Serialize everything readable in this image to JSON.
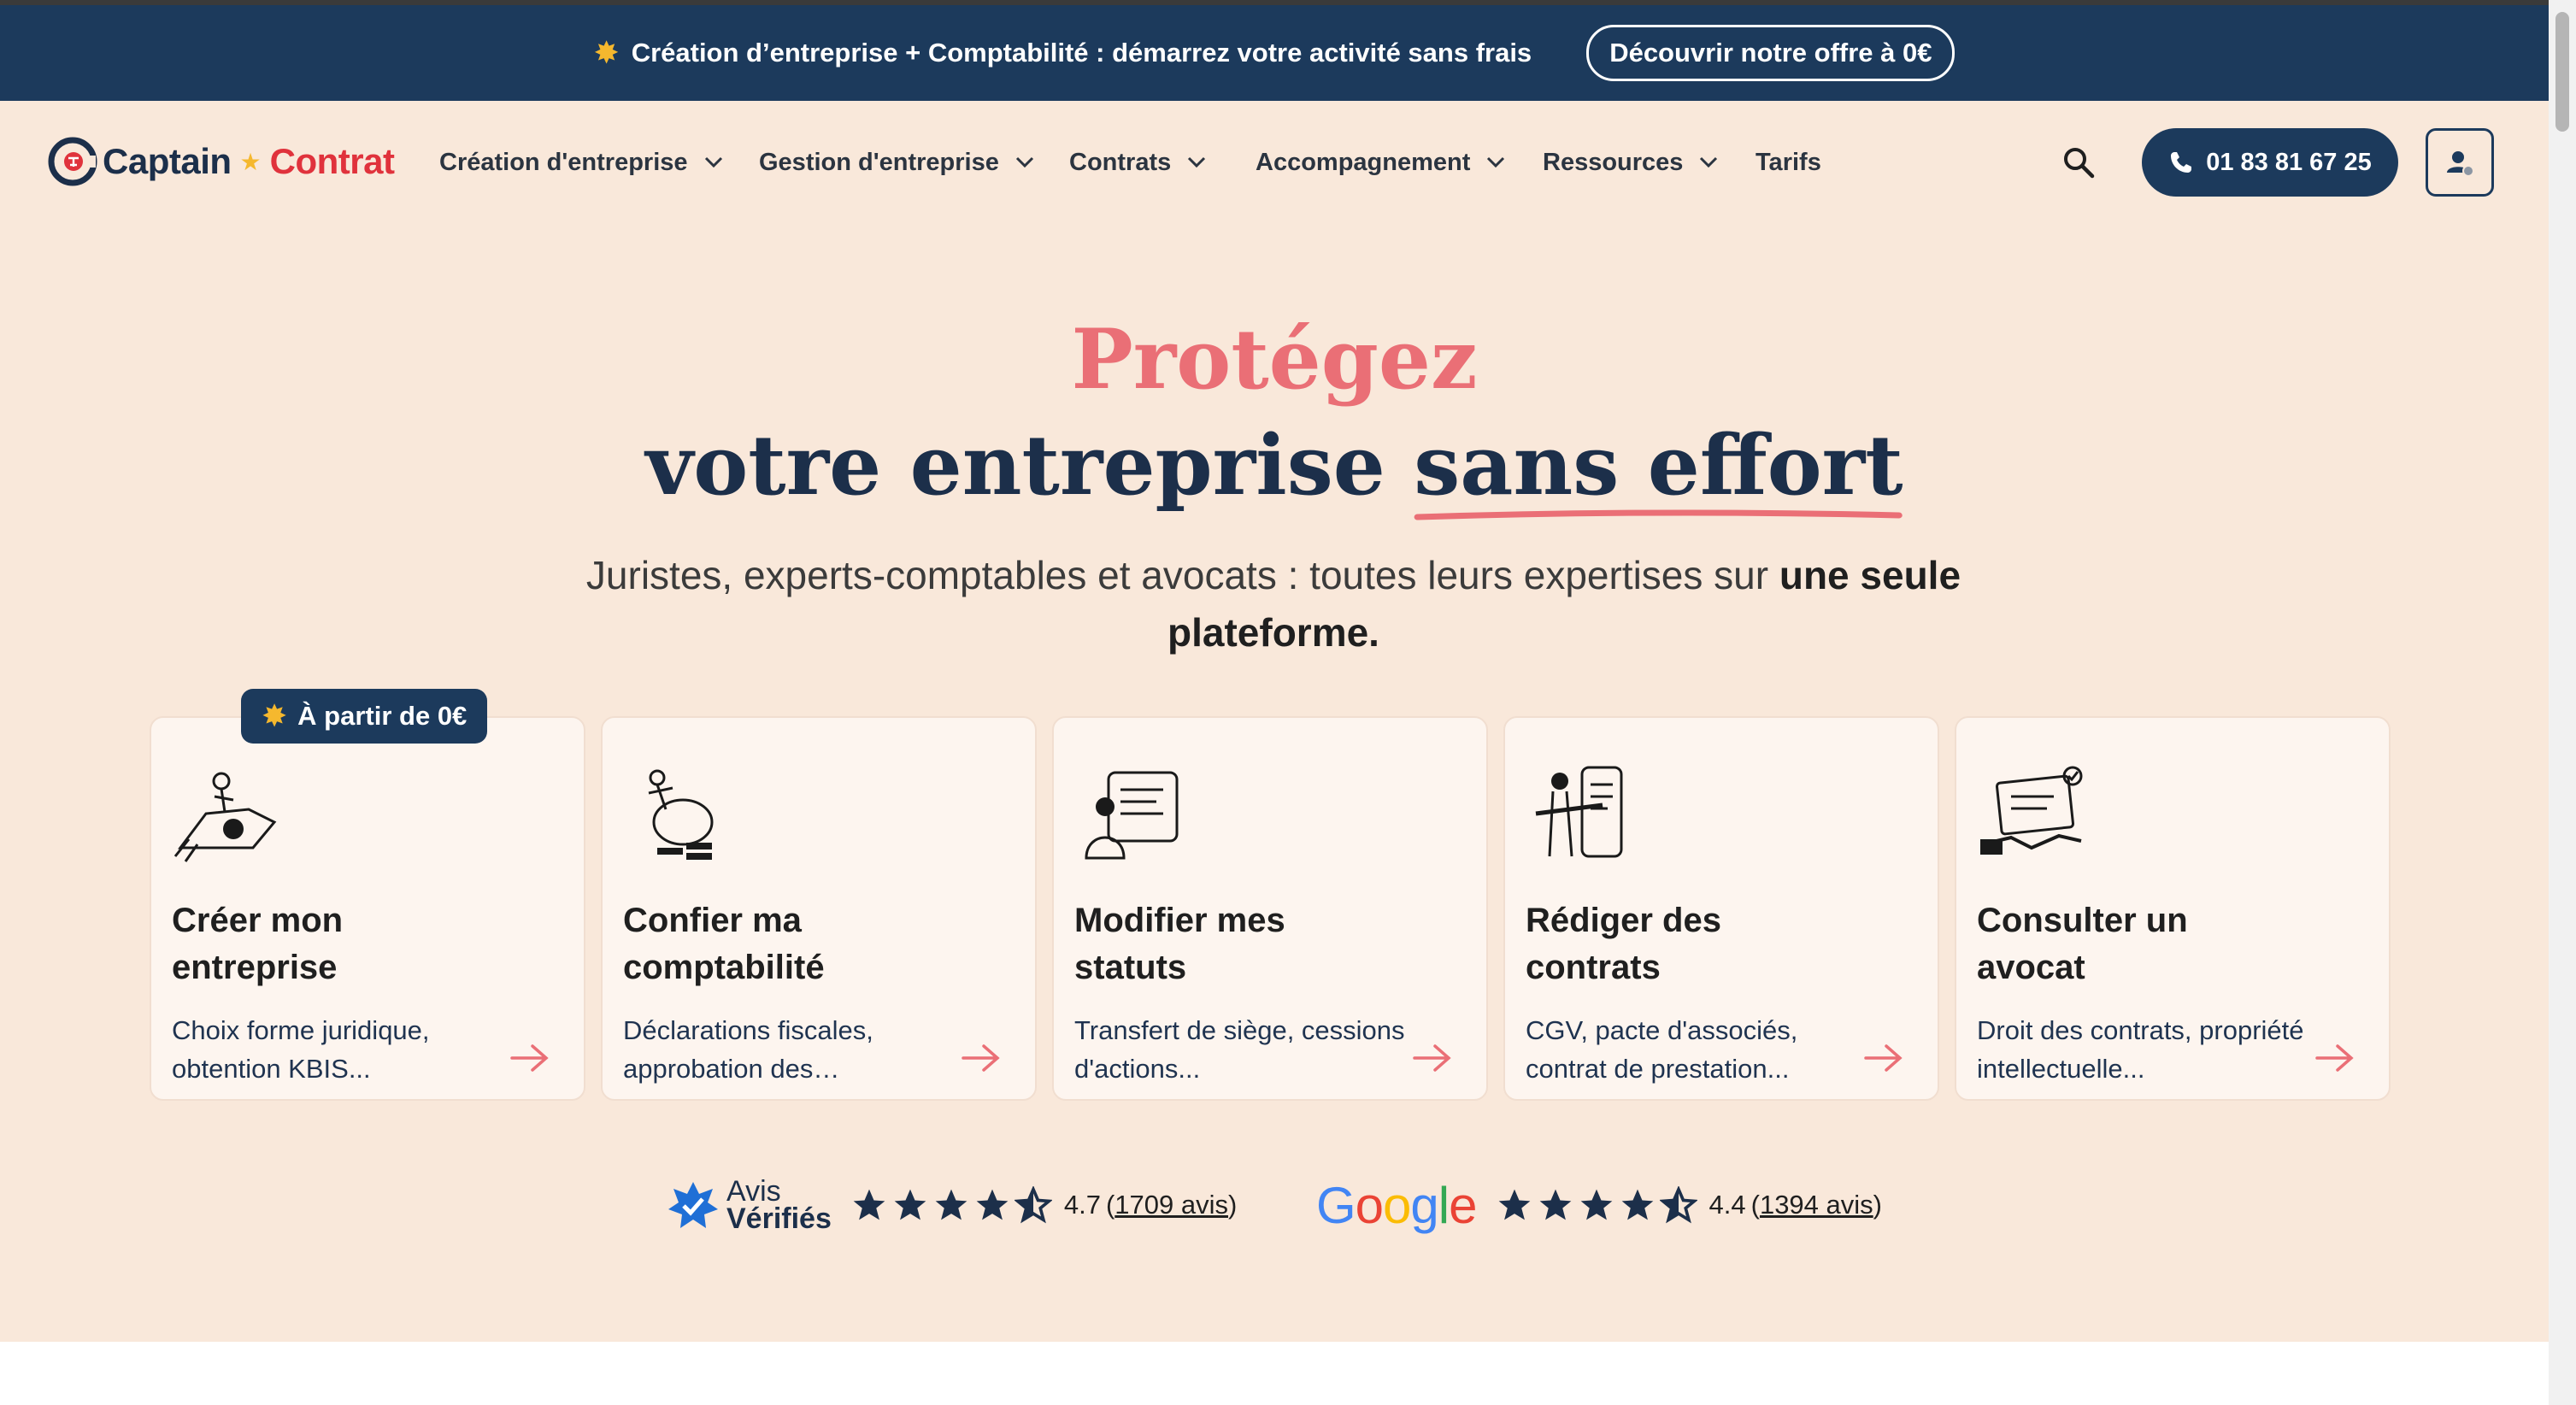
{
  "announcement": {
    "text": "Création d’entreprise + Comptabilité : démarrez votre activité sans frais",
    "button": "Découvrir notre offre à 0€"
  },
  "brand": {
    "name_part1": "Captain",
    "name_part2": "Contrat"
  },
  "nav": {
    "items": [
      {
        "label": "Création d'entreprise",
        "has_dropdown": true
      },
      {
        "label": "Gestion d'entreprise",
        "has_dropdown": true
      },
      {
        "label": "Contrats",
        "has_dropdown": true
      },
      {
        "label": "Accompagnement",
        "has_dropdown": true
      },
      {
        "label": "Ressources",
        "has_dropdown": true
      },
      {
        "label": "Tarifs",
        "has_dropdown": false
      }
    ],
    "phone": "01 83 81 67 25"
  },
  "hero": {
    "title_line1": "Protégez",
    "title_line2_a": "votre entreprise",
    "title_line2_b": "sans effort",
    "subtitle_a": "Juristes, experts-comptables et avocats : toutes leurs expertises sur",
    "subtitle_b": "une seule plateforme."
  },
  "badge": "À partir de 0€",
  "cards": [
    {
      "title": "Créer mon entreprise",
      "desc": "Choix forme juridique, obtention KBIS..."
    },
    {
      "title": "Confier ma comptabilité",
      "desc": "Déclarations fiscales, approbation des…"
    },
    {
      "title": "Modifier mes statuts",
      "desc": "Transfert de siège, cessions d'actions..."
    },
    {
      "title": "Rédiger des contrats",
      "desc": "CGV, pacte d'associés, contrat de prestation..."
    },
    {
      "title": "Consulter un avocat",
      "desc": "Droit des contrats, propriété intellectuelle..."
    }
  ],
  "ratings": [
    {
      "source_line1": "Avis",
      "source_line2": "Vérifiés",
      "score": "4.7",
      "count": "1709 avis",
      "stars": 4.5
    },
    {
      "source": "Google",
      "score": "4.4",
      "count": "1394 avis",
      "stars": 4.5
    }
  ],
  "colors": {
    "navy": "#1c3a5c",
    "hero_bg": "#f9e8da",
    "accent_pink": "#ea6f76",
    "brand_red": "#e0323c",
    "star_yellow": "#f5b82e"
  }
}
